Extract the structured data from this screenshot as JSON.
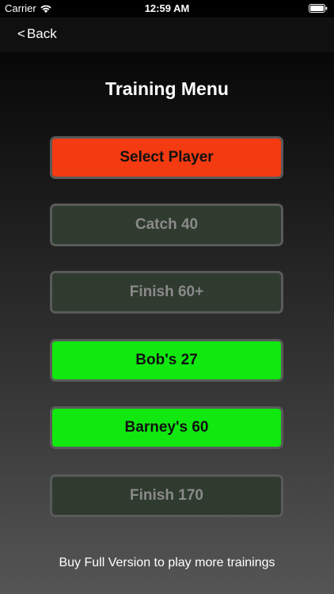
{
  "status_bar": {
    "carrier": "Carrier",
    "time": "12:59 AM"
  },
  "nav": {
    "back_label": "Back"
  },
  "page": {
    "title": "Training Menu",
    "footer_note": "Buy Full Version to play more trainings"
  },
  "menu": {
    "items": [
      {
        "label": "Select Player",
        "state": "active",
        "color": "#f33a10"
      },
      {
        "label": "Catch 40",
        "state": "locked",
        "color": "#2f3b2f"
      },
      {
        "label": "Finish 60+",
        "state": "locked",
        "color": "#2f3b2f"
      },
      {
        "label": "Bob's 27",
        "state": "available",
        "color": "#11e80f"
      },
      {
        "label": "Barney's 60",
        "state": "available",
        "color": "#11e80f"
      },
      {
        "label": "Finish 170",
        "state": "locked",
        "color": "#2f3b2f"
      }
    ]
  },
  "icons": {
    "wifi": "wifi-icon",
    "battery": "battery-icon",
    "back": "chevron-left-icon"
  }
}
